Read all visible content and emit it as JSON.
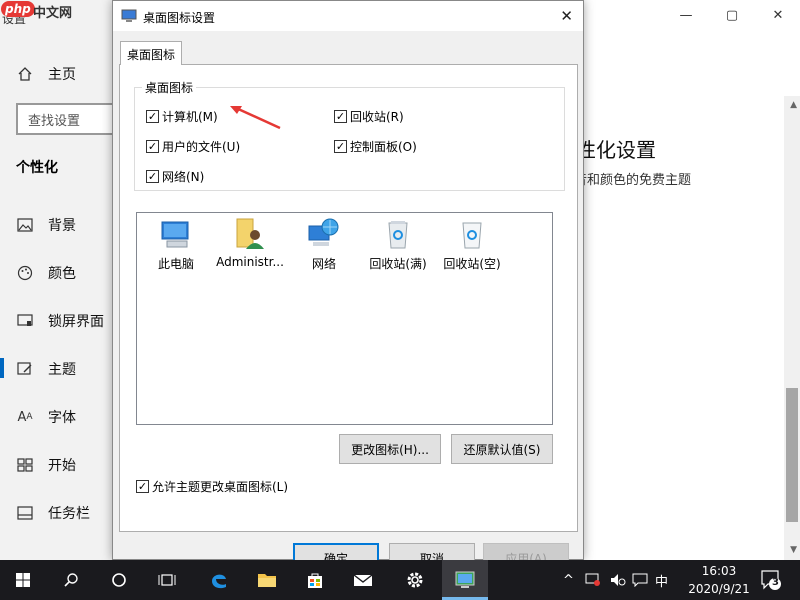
{
  "settings": {
    "title": "设置",
    "watermark": {
      "logo": "php",
      "text": "中文网"
    },
    "window_controls": {
      "minimize": "—",
      "maximize": "▢",
      "close": "✕"
    },
    "home": "主页",
    "search_placeholder": "查找设置",
    "section": "个性化",
    "nav": [
      {
        "label": "背景",
        "icon": "image-icon"
      },
      {
        "label": "颜色",
        "icon": "palette-icon"
      },
      {
        "label": "锁屏界面",
        "icon": "lock-screen-icon"
      },
      {
        "label": "主题",
        "icon": "theme-icon"
      },
      {
        "label": "字体",
        "icon": "font-icon"
      },
      {
        "label": "开始",
        "icon": "start-icon"
      },
      {
        "label": "任务栏",
        "icon": "taskbar-icon"
      }
    ],
    "right_title": "性化设置",
    "right_desc": "音和颜色的免费主题"
  },
  "dialog": {
    "title": "桌面图标设置",
    "close": "✕",
    "tab": "桌面图标",
    "group_title": "桌面图标",
    "checkboxes": [
      {
        "label": "计算机(M)",
        "checked": true
      },
      {
        "label": "回收站(R)",
        "checked": true
      },
      {
        "label": "用户的文件(U)",
        "checked": true
      },
      {
        "label": "控制面板(O)",
        "checked": true
      },
      {
        "label": "网络(N)",
        "checked": true
      }
    ],
    "icons": [
      {
        "label": "此电脑",
        "icon": "this-pc-icon"
      },
      {
        "label": "Administr...",
        "icon": "user-folder-icon"
      },
      {
        "label": "网络",
        "icon": "network-icon"
      },
      {
        "label": "回收站(满)",
        "icon": "recycle-bin-full-icon"
      },
      {
        "label": "回收站(空)",
        "icon": "recycle-bin-empty-icon"
      }
    ],
    "change_icon": "更改图标(H)...",
    "restore_default": "还原默认值(S)",
    "allow_themes": {
      "label": "允许主题更改桌面图标(L)",
      "checked": true
    },
    "ok": "确定",
    "cancel": "取消",
    "apply": "应用(A)",
    "check_mark": "✓"
  },
  "taskbar": {
    "items": [
      "windows-start-icon",
      "search-icon",
      "cortana-icon",
      "task-view-icon",
      "edge-icon",
      "file-explorer-icon",
      "store-icon",
      "mail-icon",
      "settings-gear-icon",
      "desktop-icon-settings-app-icon"
    ],
    "tray_chevron": "^",
    "ime": "中",
    "time": "16:03",
    "date": "2020/9/21",
    "notification_count": "3"
  },
  "colors": {
    "accent": "#0078d7",
    "taskbar": "#1a1a1e",
    "annotation_arrow": "#e53935"
  }
}
